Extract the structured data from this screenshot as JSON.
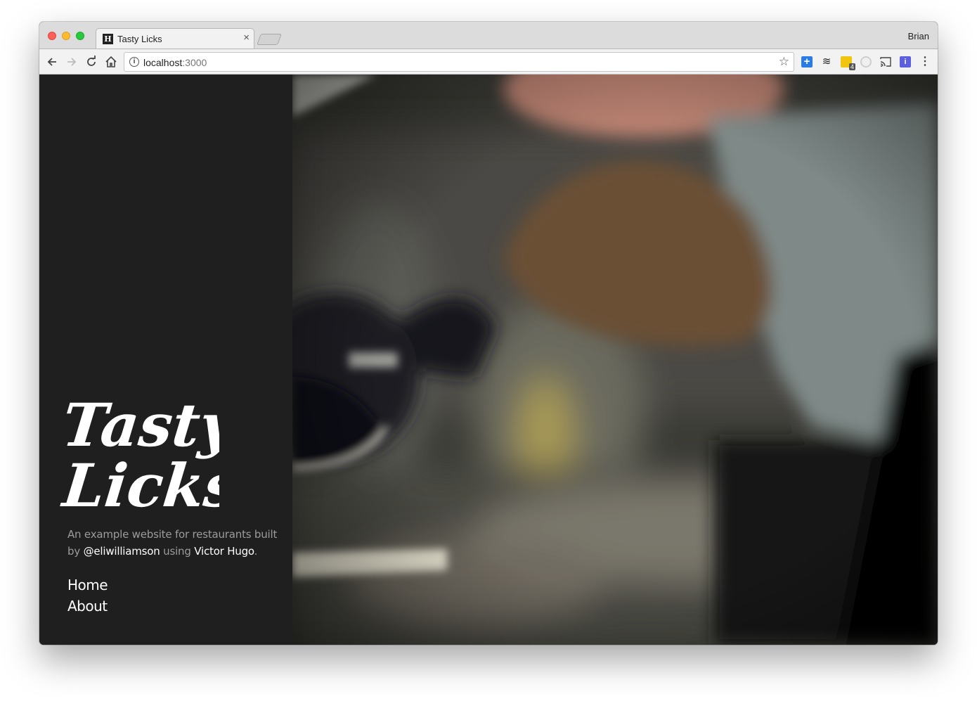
{
  "browser": {
    "tab_title": "Tasty Licks",
    "tab_favicon": "H",
    "tab_close": "×",
    "profile_name": "Brian",
    "url_host": "localhost",
    "url_port": ":3000",
    "ext_badge": "4",
    "ext_i_label": "i"
  },
  "site": {
    "logo_line1": "Tasty",
    "logo_line2": "Licks",
    "tagline": {
      "prefix": "An example website for restaurants built by",
      "author": "@eliwilliamson",
      "middle": "using",
      "theme": "Victor Hugo",
      "suffix": "."
    },
    "nav": [
      {
        "label": "Home"
      },
      {
        "label": "About"
      }
    ]
  },
  "colors": {
    "sidebar_bg": "#1f1f1f",
    "text_muted": "#9c9c9c",
    "text_link": "#ffffff"
  },
  "icons": [
    "back-icon",
    "forward-icon",
    "reload-icon",
    "home-icon",
    "info-icon",
    "star-icon",
    "cast-icon",
    "menu-icon"
  ]
}
